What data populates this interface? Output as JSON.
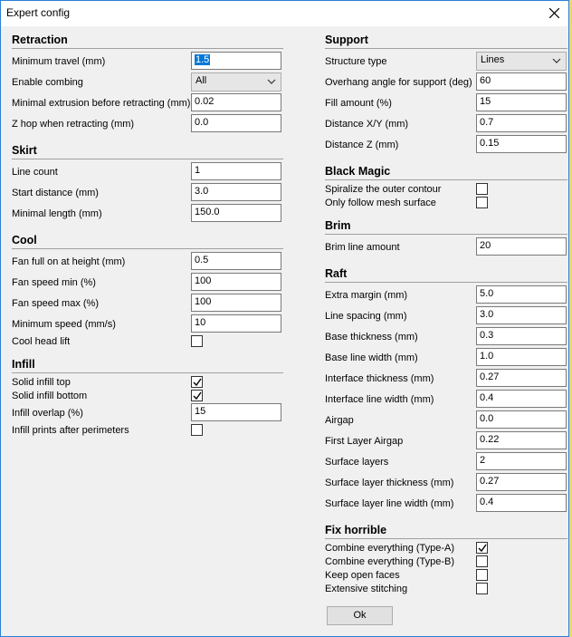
{
  "window": {
    "title": "Expert config"
  },
  "retraction": {
    "title": "Retraction",
    "min_travel": {
      "label": "Minimum travel (mm)",
      "value": "1.5"
    },
    "enable_combing": {
      "label": "Enable combing",
      "value": "All"
    },
    "min_extrusion": {
      "label": "Minimal extrusion before retracting (mm)",
      "value": "0.02"
    },
    "z_hop": {
      "label": "Z hop when retracting (mm)",
      "value": "0.0"
    }
  },
  "skirt": {
    "title": "Skirt",
    "line_count": {
      "label": "Line count",
      "value": "1"
    },
    "start_distance": {
      "label": "Start distance (mm)",
      "value": "3.0"
    },
    "min_length": {
      "label": "Minimal length (mm)",
      "value": "150.0"
    }
  },
  "cool": {
    "title": "Cool",
    "fan_full": {
      "label": "Fan full on at height (mm)",
      "value": "0.5"
    },
    "fan_min": {
      "label": "Fan speed min (%)",
      "value": "100"
    },
    "fan_max": {
      "label": "Fan speed max (%)",
      "value": "100"
    },
    "min_speed": {
      "label": "Minimum speed (mm/s)",
      "value": "10"
    },
    "head_lift": {
      "label": "Cool head lift",
      "checked": false
    }
  },
  "infill": {
    "title": "Infill",
    "solid_top": {
      "label": "Solid infill top",
      "checked": true
    },
    "solid_bottom": {
      "label": "Solid infill bottom",
      "checked": true
    },
    "overlap": {
      "label": "Infill overlap (%)",
      "value": "15"
    },
    "after_perimeters": {
      "label": "Infill prints after perimeters",
      "checked": false
    }
  },
  "support": {
    "title": "Support",
    "structure_type": {
      "label": "Structure type",
      "value": "Lines"
    },
    "overhang_angle": {
      "label": "Overhang angle for support (deg)",
      "value": "60"
    },
    "fill_amount": {
      "label": "Fill amount (%)",
      "value": "15"
    },
    "distance_xy": {
      "label": "Distance X/Y (mm)",
      "value": "0.7"
    },
    "distance_z": {
      "label": "Distance Z (mm)",
      "value": "0.15"
    }
  },
  "black_magic": {
    "title": "Black Magic",
    "spiralize": {
      "label": "Spiralize the outer contour",
      "checked": false
    },
    "mesh_surface": {
      "label": "Only follow mesh surface",
      "checked": false
    }
  },
  "brim": {
    "title": "Brim",
    "line_amount": {
      "label": "Brim line amount",
      "value": "20"
    }
  },
  "raft": {
    "title": "Raft",
    "extra_margin": {
      "label": "Extra margin (mm)",
      "value": "5.0"
    },
    "line_spacing": {
      "label": "Line spacing (mm)",
      "value": "3.0"
    },
    "base_thickness": {
      "label": "Base thickness (mm)",
      "value": "0.3"
    },
    "base_line_width": {
      "label": "Base line width (mm)",
      "value": "1.0"
    },
    "interface_thickness": {
      "label": "Interface thickness (mm)",
      "value": "0.27"
    },
    "interface_line_width": {
      "label": "Interface line width (mm)",
      "value": "0.4"
    },
    "airgap": {
      "label": "Airgap",
      "value": "0.0"
    },
    "first_layer_airgap": {
      "label": "First Layer Airgap",
      "value": "0.22"
    },
    "surface_layers": {
      "label": "Surface layers",
      "value": "2"
    },
    "surface_layer_thickness": {
      "label": "Surface layer thickness (mm)",
      "value": "0.27"
    },
    "surface_layer_line_width": {
      "label": "Surface layer line width (mm)",
      "value": "0.4"
    }
  },
  "fix_horrible": {
    "title": "Fix horrible",
    "combine_a": {
      "label": "Combine everything (Type-A)",
      "checked": true
    },
    "combine_b": {
      "label": "Combine everything (Type-B)",
      "checked": false
    },
    "open_faces": {
      "label": "Keep open faces",
      "checked": false
    },
    "stitching": {
      "label": "Extensive stitching",
      "checked": false
    }
  },
  "ok_label": "Ok",
  "colors": {
    "accent_border": "#2a7fd6",
    "selection": "#0078d7",
    "desktop": "#e9d86a"
  }
}
